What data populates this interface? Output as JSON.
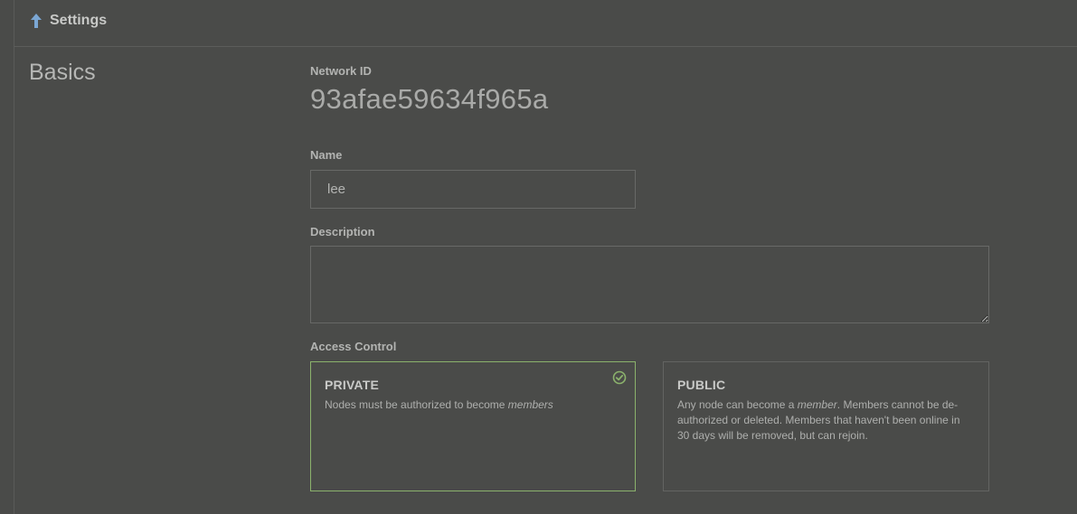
{
  "header": {
    "title": "Settings",
    "toggle_icon": "arrow-up-icon",
    "accent": "#7ba7d4"
  },
  "basics": {
    "section_title": "Basics",
    "network_id_label": "Network ID",
    "network_id": "93afae59634f965a",
    "name_label": "Name",
    "name_value": "lee",
    "description_label": "Description",
    "description_value": ""
  },
  "access_control": {
    "label": "Access Control",
    "selected": "private",
    "selected_color": "#8bb26c",
    "private": {
      "title": "PRIVATE",
      "desc_pre": "Nodes must be authorized to become ",
      "desc_em": "members",
      "desc_post": ""
    },
    "public": {
      "title": "PUBLIC",
      "desc_pre": "Any node can become a ",
      "desc_em": "member",
      "desc_post": ". Members cannot be de-authorized or deleted. Members that haven't been online in 30 days will be removed, but can rejoin."
    }
  }
}
